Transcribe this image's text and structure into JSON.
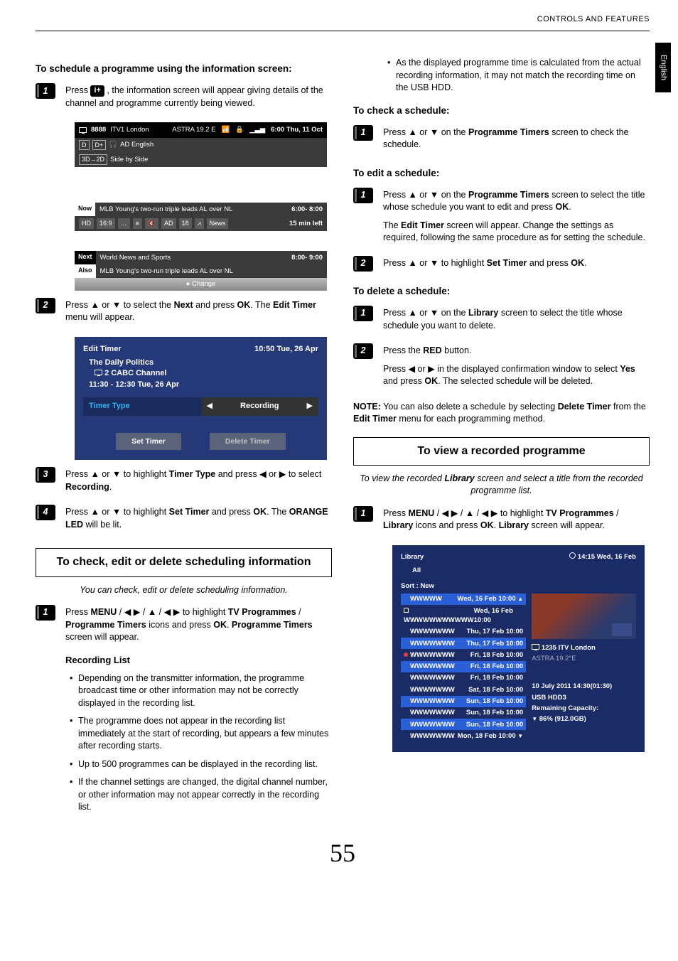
{
  "header": {
    "section": "CONTROLS AND FEATURES",
    "side_tab": "English"
  },
  "page_number": "55",
  "left": {
    "heading1": "To schedule a programme using the information screen:",
    "step1": {
      "num": "1",
      "text_a": "Press ",
      "icon_label": "i+",
      "text_b": " , the information screen will appear giving details of the channel and programme currently being viewed."
    },
    "info_screen": {
      "ch_num": "8888",
      "ch_name": "ITV1 London",
      "sat": "ASTRA 19.2 E",
      "clock": "6:00 Thu, 11 Oct",
      "audio_chip1": "D",
      "audio_chip2": "D+",
      "audio_desc": "AD English",
      "mode3d": "3D→2D",
      "sbs": "Side by Side",
      "now_label": "Now",
      "now_title": "MLB Young's two-run triple leads AL over NL",
      "now_time": "6:00- 8:00",
      "meta": {
        "hd": "HD",
        "aspect": "16:9",
        "ad": "AD",
        "age": "18",
        "cat": "News",
        "left": "15 min left"
      },
      "next_label": "Next",
      "next_title": "World News and Sports",
      "next_time": "8:00- 9:00",
      "also_label": "Also",
      "also_title": "MLB Young's two-run triple leads AL over NL",
      "change": "Change"
    },
    "step2": {
      "num": "2",
      "text_pre": "Press ",
      "text_mid1": " or ",
      "text_mid2": " to select the ",
      "next": "Next",
      "text_mid3": " and press ",
      "ok": "OK",
      "text_post": ". The ",
      "edit_timer": "Edit Timer",
      "text_end": " menu will appear."
    },
    "edit_timer": {
      "title": "Edit Timer",
      "clock": "10:50 Tue, 26 Apr",
      "prog": "The Daily Politics",
      "chan": "2 CABC Channel",
      "time": "11:30 - 12:30 Tue, 26 Apr",
      "row_l": "Timer Type",
      "row_r": "Recording",
      "btn1": "Set Timer",
      "btn2": "Delete Timer"
    },
    "step3": {
      "num": "3",
      "pre": "Press ",
      " mid1": " or ",
      "txt": " to highlight ",
      "tt": "Timer Type",
      "mid2": " and press ",
      "mid3": " or ",
      "mid4": " to select ",
      "rec": "Recording",
      "end": "."
    },
    "step4": {
      "num": "4",
      "pre": "Press ",
      "txt": " to highlight ",
      "st": "Set Timer",
      "mid": " and press ",
      "ok": "OK",
      "end1": ". The ",
      "led": "ORANGE LED",
      "end2": " will be lit."
    },
    "section2_title": "To check, edit or delete scheduling information",
    "section2_intro": "You can check, edit or delete scheduling information.",
    "step1b": {
      "num": "1",
      "pre": "Press ",
      "menu": "MENU",
      "mid": " / ",
      "txt": " to highlight ",
      "tvp": "TV Programmes",
      "pt": "Programme Timers",
      "mid2": " icons and press ",
      "ok": "OK",
      "end": ". ",
      "pt2": "Programme Timers",
      "tail": " screen will appear."
    },
    "reclist_title": "Recording List",
    "bullets": [
      "Depending on the transmitter information, the programme broadcast time or other information may not be correctly displayed in the recording list.",
      "The programme does not appear in the recording list immediately at the start of recording, but appears a few minutes after recording starts.",
      "Up to 500 programmes can be displayed in the recording list.",
      "If the channel settings are changed, the digital channel number, or other information may not appear correctly in the recording list."
    ]
  },
  "right": {
    "bullet_top": "As the displayed programme time is calculated from the actual recording information, it may not match the recording time on the USB HDD.",
    "check_title": "To check a schedule:",
    "check_step": {
      "num": "1",
      "pre": "Press ",
      "mid": " or ",
      "on": " on the ",
      "pt": "Programme Timers",
      "end": " screen to check the schedule."
    },
    "edit_title": "To edit a schedule:",
    "edit_step1": {
      "num": "1",
      "p1_pre": "Press ",
      "p1_on": " on the ",
      "pt": "Programme Timers",
      "p1_end": " screen to select the title whose schedule you want to edit and press ",
      "ok": "OK",
      "p1_dot": ".",
      "p2_the": "The ",
      "et": "Edit Timer",
      "p2_end": " screen will appear. Change the settings as required, following the same procedure as for setting the schedule."
    },
    "edit_step2": {
      "num": "2",
      "pre": "Press ",
      "txt": " to highlight ",
      "st": "Set Timer",
      "mid": " and press ",
      "ok": "OK",
      "dot": "."
    },
    "del_title": "To delete a schedule:",
    "del_step1": {
      "num": "1",
      "pre": "Press ",
      "on": " on the ",
      "lib": "Library",
      "end": " screen to select the title whose schedule you want to delete."
    },
    "del_step2": {
      "num": "2",
      "l1_pre": "Press the ",
      "red": "RED",
      "l1_end": " button.",
      "l2_pre": "Press ",
      "l2_mid": " or ",
      "l2_txt": " in the displayed confirmation window to select ",
      "yes": "Yes",
      "l2_mid2": " and press ",
      "ok": "OK",
      "l2_end": ". The selected schedule will be deleted."
    },
    "note": {
      "label": "NOTE:",
      "body": " You can also delete a schedule by selecting ",
      "dt": "Delete Timer",
      "body2": " from the ",
      "et": "Edit Timer",
      "body3": " menu for each programming method."
    },
    "section3_title": "To view a recorded programme",
    "section3_intro_pre": "To view the recorded ",
    "section3_lib": "Library",
    "section3_intro_post": " screen and select a title from the recorded programme list.",
    "view_step": {
      "num": "1",
      "pre": "Press ",
      "menu": "MENU",
      "txt": " to highlight ",
      "tvp": "TV Programmes",
      "lib": "Library",
      "mid": " icons and press ",
      "ok": "OK",
      "end": ". ",
      "lib2": "Library",
      "tail": " screen will appear."
    },
    "library": {
      "title": "Library",
      "all": "All",
      "clock": "14:15 Wed, 16 Feb",
      "sort": "Sort : New",
      "rows": [
        {
          "name": "WWWWW",
          "date": "Wed, 16 Feb 10:00",
          "hl": true
        },
        {
          "name": "WWWWWWWWWWW",
          "date": "Wed, 16 Feb 10:00"
        },
        {
          "name": "WWWWWWW",
          "date": "Thu, 17 Feb 10:00"
        },
        {
          "name": "WWWWWWW",
          "date": "Thu, 17 Feb 10:00",
          "hl": true
        },
        {
          "name": "WWWWWWW",
          "date": "Fri, 18 Feb 10:00"
        },
        {
          "name": "WWWWWWW",
          "date": "Fri, 18 Feb 10:00",
          "hl": true
        },
        {
          "name": "WWWWWWW",
          "date": "Fri, 18 Feb 10:00"
        },
        {
          "name": "WWWWWWW",
          "date": "Sat, 18 Feb 10:00"
        },
        {
          "name": "WWWWWWW",
          "date": "Sun, 18 Feb 10:00",
          "hl": true
        },
        {
          "name": "WWWWWWW",
          "date": "Sun, 18 Feb 10:00"
        },
        {
          "name": "WWWWWWW",
          "date": "Sun, 18 Feb 10:00",
          "hl": true
        },
        {
          "name": "WWWWWWW",
          "date": "Mon, 18 Feb 10:00"
        }
      ],
      "info": {
        "ch": "1235 ITV London",
        "sat": "ASTRA 19.2°E",
        "rec_time": "10 July 2011  14:30(01:30)",
        "hdd": "USB HDD3",
        "cap_label": "Remaining Capacity:",
        "cap": "86% (912.0GB)"
      }
    }
  }
}
